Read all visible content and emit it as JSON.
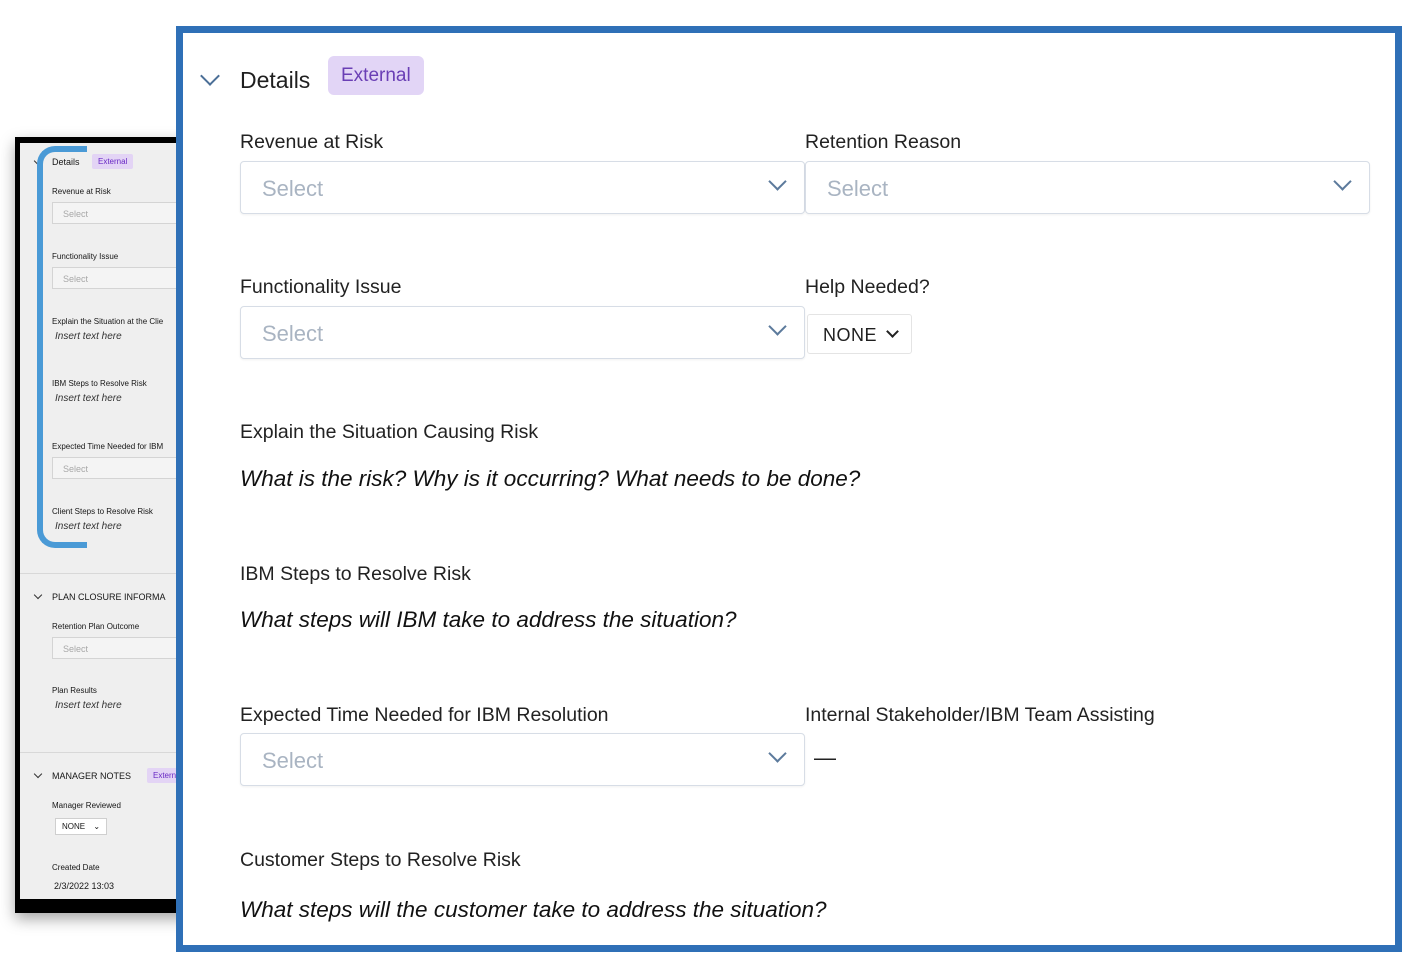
{
  "thumbnail": {
    "details_title": "Details",
    "details_badge": "External",
    "revenue_label": "Revenue at Risk",
    "revenue_placeholder": "Select",
    "functionality_label": "Functionality Issue",
    "functionality_placeholder": "Select",
    "explain_label": "Explain the Situation at the Clie",
    "explain_value": "Insert text here",
    "ibm_steps_label": "IBM Steps to Resolve Risk",
    "ibm_steps_value": "Insert text here",
    "expected_time_label": "Expected Time Needed for IBM",
    "expected_time_placeholder": "Select",
    "client_steps_label": "Client Steps to Resolve Risk",
    "client_steps_value": "Insert text here",
    "plan_closure_title": "PLAN CLOSURE INFORMA",
    "retention_outcome_label": "Retention Plan Outcome",
    "retention_outcome_placeholder": "Select",
    "plan_results_label": "Plan Results",
    "plan_results_value": "Insert text here",
    "manager_notes_title": "MANAGER NOTES",
    "manager_notes_badge": "Extern",
    "manager_reviewed_label": "Manager Reviewed",
    "manager_reviewed_value": "NONE",
    "created_date_label": "Created Date",
    "created_date_value": "2/3/2022 13:03"
  },
  "details": {
    "title": "Details",
    "badge": "External",
    "revenue_at_risk": {
      "label": "Revenue at Risk",
      "placeholder": "Select"
    },
    "retention_reason": {
      "label": "Retention Reason",
      "placeholder": "Select"
    },
    "functionality_issue": {
      "label": "Functionality Issue",
      "placeholder": "Select"
    },
    "help_needed": {
      "label": "Help Needed?",
      "value": "NONE"
    },
    "explain_situation": {
      "label": "Explain the Situation Causing Risk",
      "prompt": "What is the risk? Why is it occurring? What needs to be done?"
    },
    "ibm_steps": {
      "label": "IBM Steps to Resolve Risk",
      "prompt": "What steps will IBM take to address the situation?"
    },
    "expected_time": {
      "label": "Expected Time Needed for IBM Resolution",
      "placeholder": "Select"
    },
    "internal_stakeholder": {
      "label": "Internal Stakeholder/IBM Team Assisting",
      "value": "—"
    },
    "customer_steps": {
      "label": "Customer Steps to Resolve Risk",
      "prompt": "What steps will the customer take to address the situation?"
    }
  },
  "colors": {
    "panel_border": "#2f70b7",
    "badge_bg": "#e2d5f6",
    "badge_text": "#6a3fb5",
    "bracket": "#4a9ad6",
    "placeholder": "#a9b4c2"
  },
  "icons": {
    "collapse": "chevron-down-icon",
    "dropdown": "chevron-down-icon"
  }
}
